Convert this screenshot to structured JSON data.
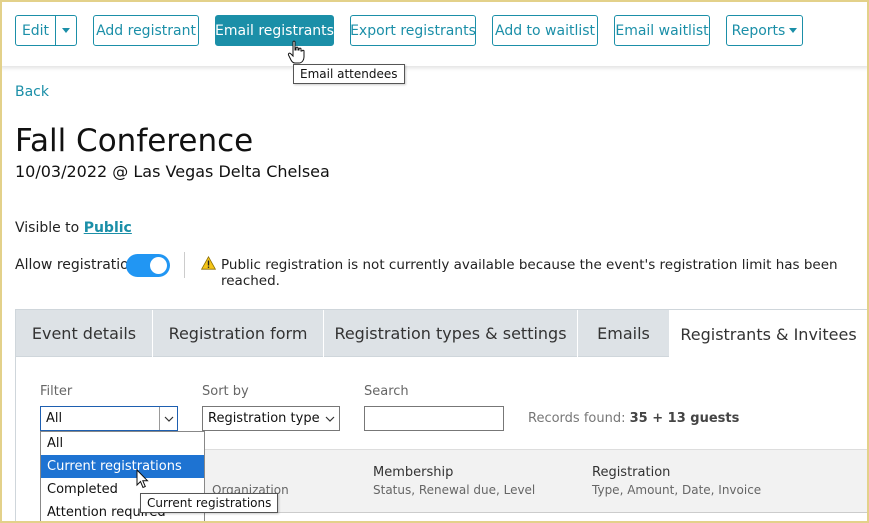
{
  "toolbar": {
    "edit_label": "Edit",
    "add_registrant_label": "Add registrant",
    "email_registrants_label": "Email registrants",
    "export_registrants_label": "Export registrants",
    "add_to_waitlist_label": "Add to waitlist",
    "email_waitlist_label": "Email waitlist",
    "reports_label": "Reports",
    "tooltip": "Email attendees"
  },
  "nav": {
    "back_label": "Back"
  },
  "event": {
    "title": "Fall Conference",
    "subtitle": "10/03/2022 @ Las Vegas Delta Chelsea",
    "visible_to_label": "Visible to",
    "visible_to_value": "Public",
    "allow_registration_label": "Allow registration",
    "allow_registration_on": true,
    "warning_text": "Public registration is not currently available because the event's registration limit has been reached."
  },
  "tabs": [
    {
      "label": "Event details"
    },
    {
      "label": "Registration form"
    },
    {
      "label": "Registration types & settings"
    },
    {
      "label": "Emails"
    },
    {
      "label": "Registrants & Invitees",
      "active": true
    }
  ],
  "filters": {
    "filter_label": "Filter",
    "filter_value": "All",
    "sort_label": "Sort by",
    "sort_value": "Registration type ↑",
    "search_label": "Search",
    "search_value": "",
    "records_label": "Records found:",
    "records_value": "35 + 13 guests"
  },
  "filter_options": [
    {
      "label": "All"
    },
    {
      "label": "Current registrations",
      "selected": true
    },
    {
      "label": "Completed"
    },
    {
      "label": "Attention required"
    }
  ],
  "filter_tooltip": "Current registrations",
  "table": {
    "columns": [
      {
        "title": "",
        "subtitle": "Organization"
      },
      {
        "title": "Membership",
        "subtitle": "Status, Renewal due, Level"
      },
      {
        "title": "Registration",
        "subtitle": "Type, Amount, Date, Invoice"
      }
    ]
  },
  "colors": {
    "accent": "#1b8fa8",
    "toggle_on": "#2196f3",
    "warning": "#f5c518",
    "selected_option": "#1e73d2"
  }
}
